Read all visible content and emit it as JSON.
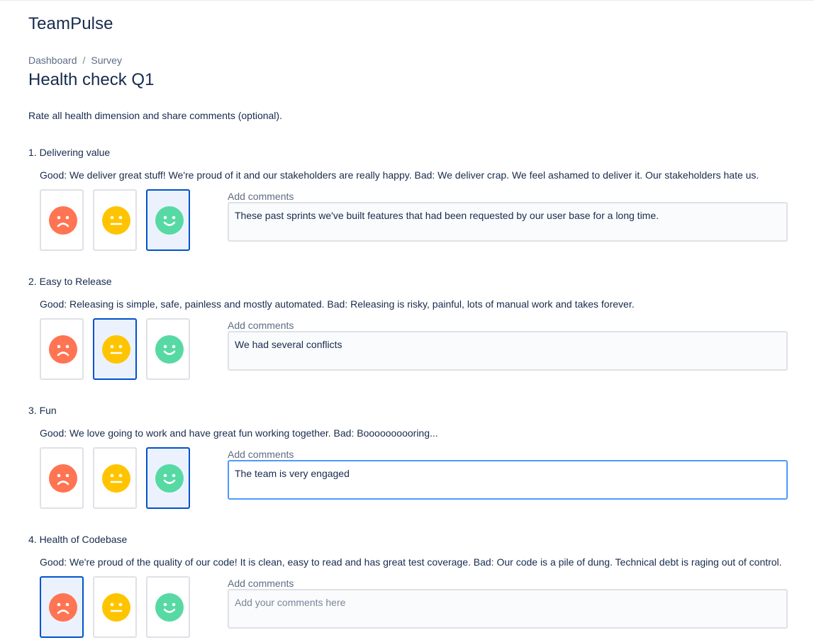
{
  "app": {
    "title": "TeamPulse"
  },
  "breadcrumb": {
    "items": [
      "Dashboard",
      "Survey"
    ],
    "separator": "/"
  },
  "page": {
    "title": "Health check Q1",
    "intro": "Rate all health dimension and share comments (optional)."
  },
  "colors": {
    "bad": "#ff7452",
    "neutral": "#ffc400",
    "good": "#57d9a3",
    "selected_border": "#0052cc",
    "focus_border": "#4c9aff"
  },
  "questions": [
    {
      "title": "1. Delivering value",
      "description": "Good: We deliver great stuff! We're proud of it and our stakeholders are really happy. Bad: We deliver crap. We feel ashamed to deliver it. Our stakeholders hate us.",
      "selected": "good",
      "comment_label": "Add comments",
      "comment": "These past sprints we've built features that had been requested by our user base for a long time."
    },
    {
      "title": "2. Easy to Release",
      "description": "Good: Releasing is simple, safe, painless and mostly automated. Bad: Releasing is risky, painful, lots of manual work and takes forever.",
      "selected": "neutral",
      "comment_label": "Add comments",
      "comment": "We had several conflicts"
    },
    {
      "title": "3. Fun",
      "description": "Good: We love going to work and have great fun working together. Bad: Boooooooooring...",
      "selected": "good",
      "comment_label": "Add comments",
      "comment": "The team is very engaged"
    },
    {
      "title": "4. Health of Codebase",
      "description": "Good: We're proud of the quality of our code! It is clean, easy to read and has great test coverage. Bad: Our code is a pile of dung. Technical debt is raging out of control.",
      "selected": "bad",
      "comment_label": "Add comments",
      "comment": "",
      "comment_placeholder": "Add your comments here"
    }
  ]
}
